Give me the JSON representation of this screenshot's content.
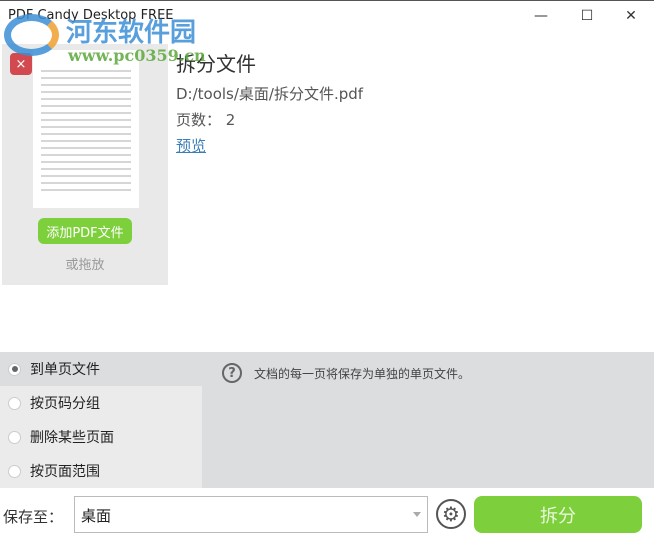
{
  "window": {
    "title": "PDF Candy Desktop FREE",
    "minimize": "—",
    "maximize": "☐",
    "close": "✕"
  },
  "file": {
    "name": "拆分文件",
    "path": "D:/tools/桌面/拆分文件.pdf",
    "pages": "页数： 2",
    "preview": "预览",
    "remove_icon": "×"
  },
  "add": {
    "button": "添加PDF文件",
    "drop": "或拖放"
  },
  "options": {
    "items": [
      {
        "label": "到单页文件",
        "selected": true
      },
      {
        "label": "按页码分组",
        "selected": false
      },
      {
        "label": "删除某些页面",
        "selected": false
      },
      {
        "label": "按页面范围",
        "selected": false
      }
    ],
    "help_icon": "?",
    "help_text": "文档的每一页将保存为单独的单页文件。"
  },
  "bottom": {
    "save_label": "保存至：",
    "save_value": "桌面",
    "gear_icon": "⚙",
    "split": "拆分"
  },
  "watermark": {
    "name": "河东软件园",
    "url": "www.pc0359.cn"
  },
  "colors": {
    "accent": "#7dcf3b",
    "remove": "#d24a4f",
    "link": "#3b7db7"
  }
}
